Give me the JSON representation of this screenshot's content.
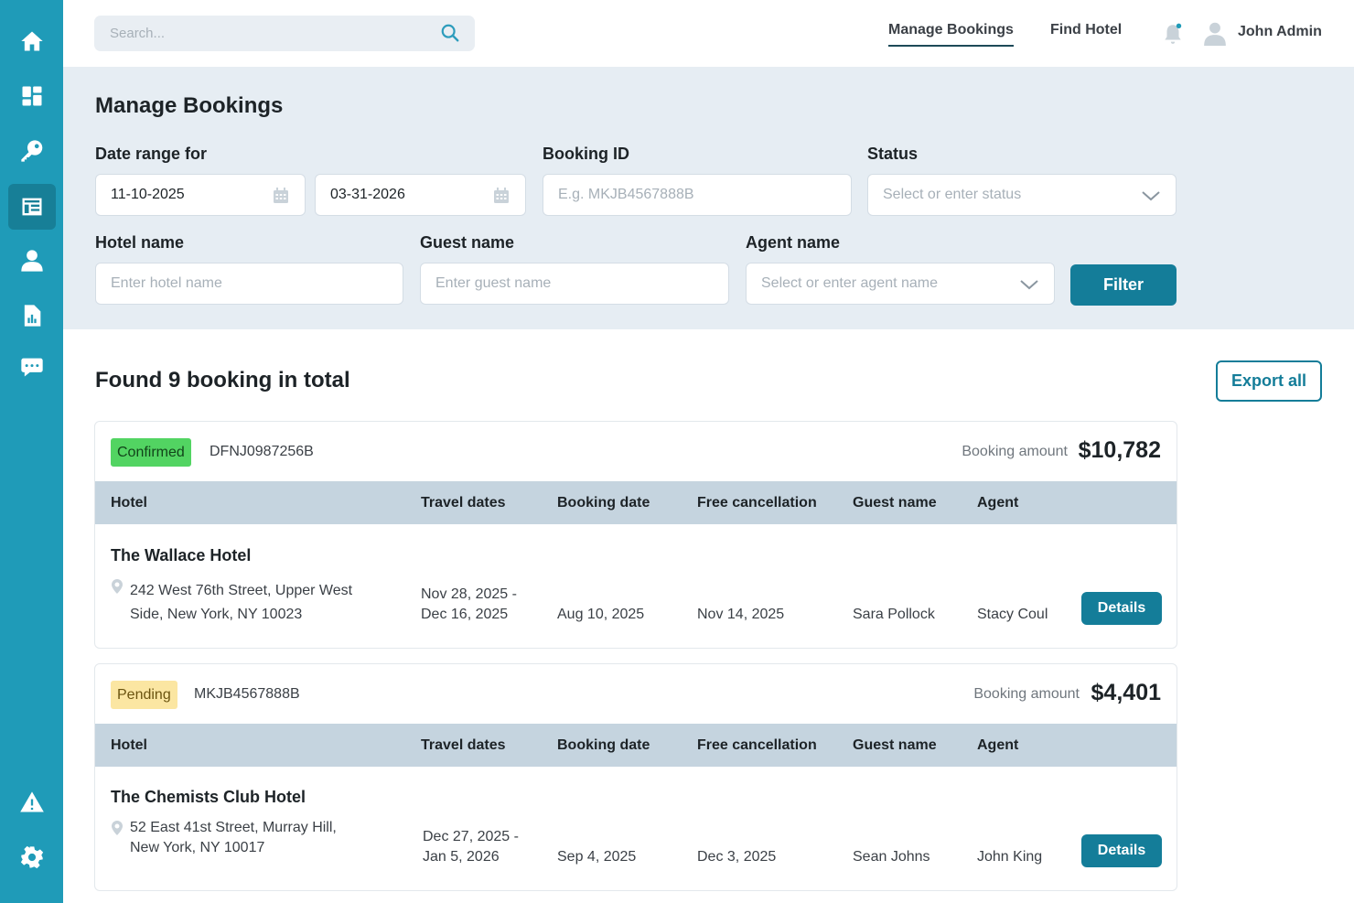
{
  "sidebar": {
    "items": [
      {
        "icon": "home-icon"
      },
      {
        "icon": "dashboard-icon"
      },
      {
        "icon": "key-icon"
      },
      {
        "icon": "bookings-icon",
        "active": true
      },
      {
        "icon": "user-icon"
      },
      {
        "icon": "report-icon"
      },
      {
        "icon": "chat-icon"
      }
    ],
    "bottom_items": [
      {
        "icon": "warning-icon"
      },
      {
        "icon": "gear-icon"
      }
    ]
  },
  "header": {
    "search_placeholder": "Search...",
    "nav": [
      {
        "label": "Manage Bookings",
        "active": true
      },
      {
        "label": "Find Hotel",
        "active": false
      }
    ],
    "user_name": "John Admin"
  },
  "filters": {
    "title": "Manage Bookings",
    "date_range_label": "Date range for",
    "date_from": "11-10-2025",
    "date_to": "03-31-2026",
    "booking_id_label": "Booking ID",
    "booking_id_placeholder": "E.g. MKJB4567888B",
    "status_label": "Status",
    "status_placeholder": "Select or enter status",
    "hotel_label": "Hotel name",
    "hotel_placeholder": "Enter hotel name",
    "guest_label": "Guest name",
    "guest_placeholder": "Enter guest name",
    "agent_label": "Agent name",
    "agent_placeholder": "Select or enter agent name",
    "filter_button": "Filter"
  },
  "results": {
    "title": "Found 9 booking in total",
    "export_button": "Export all",
    "columns": [
      "Hotel",
      "Travel dates",
      "Booking date",
      "Free cancellation",
      "Guest name",
      "Agent"
    ],
    "amount_label": "Booking amount",
    "details_button": "Details",
    "bookings": [
      {
        "status": "Confirmed",
        "id": "DFNJ0987256B",
        "amount": "$10,782",
        "hotel": "The Wallace Hotel",
        "address_line1": "242 West 76th Street, Upper West",
        "address_line2": "Side, New York, NY 10023",
        "travel_from": "Nov 28, 2025 -",
        "travel_to": "Dec 16, 2025",
        "booking_date": "Aug 10, 2025",
        "free_cancellation": "Nov 14, 2025",
        "guest": "Sara Pollock",
        "agent": "Stacy Coul"
      },
      {
        "status": "Pending",
        "id": "MKJB4567888B",
        "amount": "$4,401",
        "hotel": "The Chemists Club Hotel",
        "address_line1": "52 East 41st Street, Murray Hill,",
        "address_line2": "New York, NY 10017",
        "travel_from": "Dec 27, 2025 -",
        "travel_to": "Jan 5, 2026",
        "booking_date": "Sep 4, 2025",
        "free_cancellation": "Dec 3, 2025",
        "guest": "Sean Johns",
        "agent": "John King"
      }
    ]
  },
  "colors": {
    "sidebar": "#1f9bb8",
    "primary": "#147d99",
    "panel": "#e6edf3",
    "table_header": "#c5d4df",
    "confirmed": "#52d462",
    "pending": "#fbe6a2"
  }
}
